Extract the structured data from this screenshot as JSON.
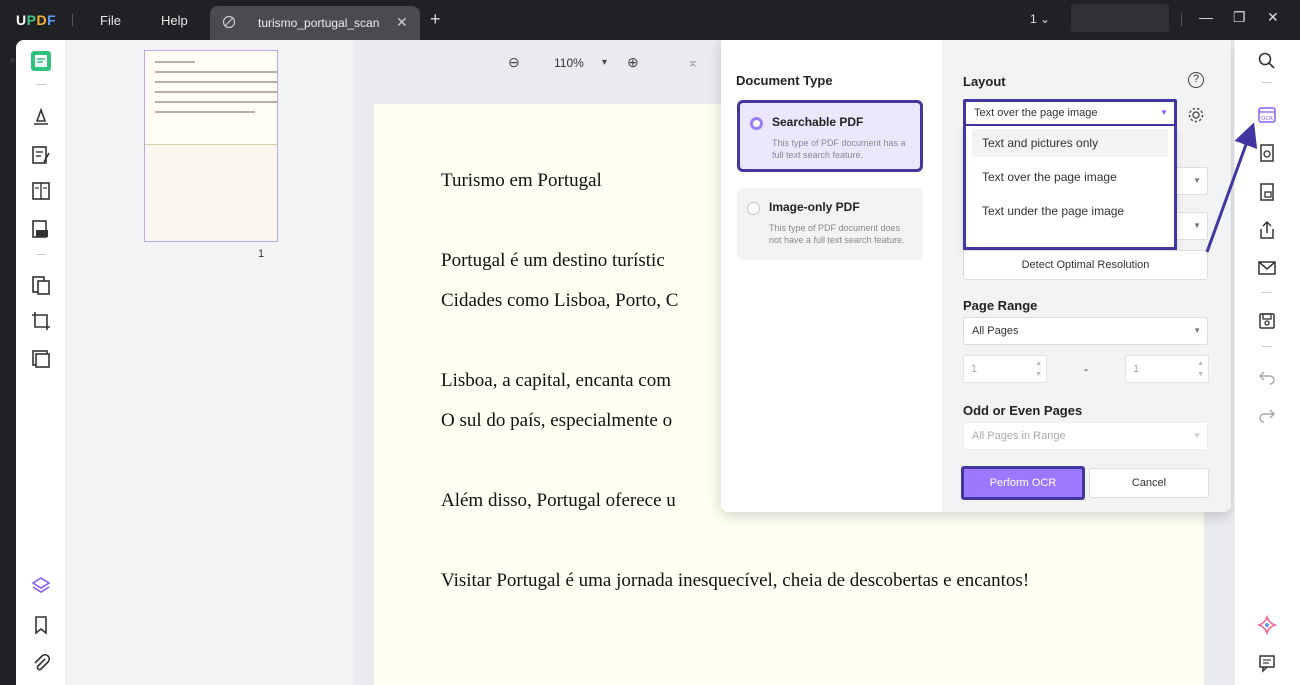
{
  "app": {
    "logo": "UPDF"
  },
  "menu": {
    "file": "File",
    "help": "Help"
  },
  "tab": {
    "title": "turismo_portugal_scan",
    "close": "✕",
    "add": "+"
  },
  "titlebar": {
    "page_selector": "1 ⌄",
    "minimize": "—",
    "maximize": "❐",
    "close": "✕"
  },
  "toolbar": {
    "zoom": "110%",
    "zoom_out": "⊖",
    "zoom_in": "⊕",
    "dropdown": "▾",
    "first_page": "⌅"
  },
  "thumbnails": {
    "page_number": "1"
  },
  "document": {
    "lines": [
      "Turismo em Portugal",
      "Portugal é um destino turístic",
      "Cidades como Lisboa, Porto, C",
      "Lisboa, a capital, encanta com",
      "O sul do país, especialmente o",
      "Além disso, Portugal oferece u",
      "Visitar Portugal é uma jornada inesquecível, cheia de descobertas e encantos!"
    ]
  },
  "ocr_dialog": {
    "document_type_title": "Document Type",
    "options": [
      {
        "title": "Searchable PDF",
        "desc": "This type of PDF document has a full text search feature.",
        "selected": true
      },
      {
        "title": "Image-only PDF",
        "desc": "This type of PDF document does not have a full text search feature.",
        "selected": false
      }
    ],
    "layout_title": "Layout",
    "help": "?",
    "layout_value": "Text over the page image",
    "layout_options": [
      "Text and pictures only",
      "Text over the page image",
      "Text under the page image"
    ],
    "detect_button": "Detect Optimal Resolution",
    "page_range_title": "Page Range",
    "page_range_value": "All Pages",
    "page_from": "1",
    "page_to": "1",
    "dash": "-",
    "odd_even_title": "Odd or Even Pages",
    "odd_even_value": "All Pages in Range",
    "perform_button": "Perform OCR",
    "cancel_button": "Cancel"
  },
  "colors": {
    "accent": "#9b78ff",
    "highlight_border": "#4237a0",
    "page_bg": "#fffff2"
  }
}
